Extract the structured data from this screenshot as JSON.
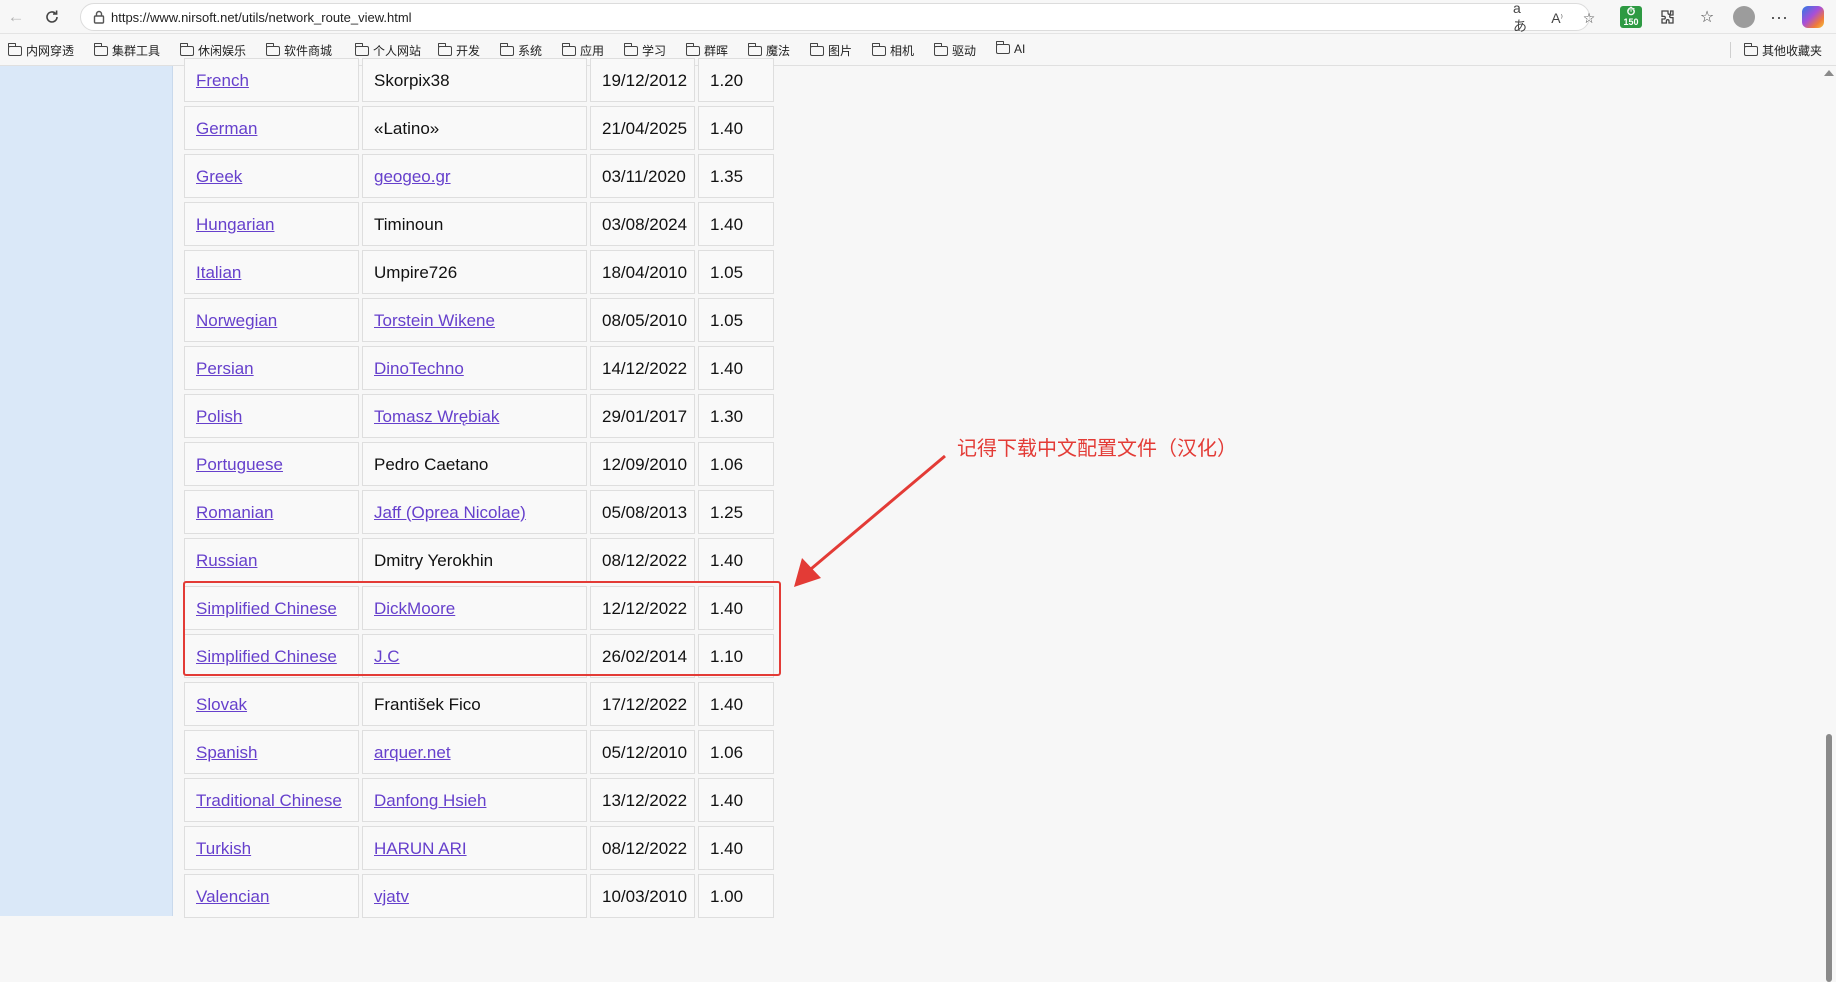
{
  "address_bar": {
    "url": "https://www.nirsoft.net/utils/network_route_view.html",
    "extension_badge": "150"
  },
  "bookmarks": {
    "items": [
      "内网穿透",
      "集群工具",
      "休闲娱乐",
      "软件商城",
      "个人网站",
      "开发",
      "系统",
      "应用",
      "学习",
      "群晖",
      "魔法",
      "图片",
      "相机",
      "驱动",
      "AI"
    ],
    "other": "其他收藏夹"
  },
  "table": {
    "rows": [
      {
        "language": "French",
        "translator": "Skorpix38",
        "translator_link": false,
        "date": "19/12/2012",
        "version": "1.20"
      },
      {
        "language": "German",
        "translator": "«Latino»",
        "translator_link": false,
        "date": "21/04/2025",
        "version": "1.40"
      },
      {
        "language": "Greek",
        "translator": "geogeo.gr",
        "translator_link": true,
        "date": "03/11/2020",
        "version": "1.35"
      },
      {
        "language": "Hungarian",
        "translator": "Timinoun",
        "translator_link": false,
        "date": "03/08/2024",
        "version": "1.40"
      },
      {
        "language": "Italian",
        "translator": "Umpire726",
        "translator_link": false,
        "date": "18/04/2010",
        "version": "1.05"
      },
      {
        "language": "Norwegian",
        "translator": "Torstein Wikene",
        "translator_link": true,
        "date": "08/05/2010",
        "version": "1.05"
      },
      {
        "language": "Persian",
        "translator": "DinoTechno",
        "translator_link": true,
        "date": "14/12/2022",
        "version": "1.40"
      },
      {
        "language": "Polish",
        "translator": "Tomasz Wrębiak",
        "translator_link": true,
        "date": "29/01/2017",
        "version": "1.30"
      },
      {
        "language": "Portuguese",
        "translator": "Pedro Caetano",
        "translator_link": false,
        "date": "12/09/2010",
        "version": "1.06"
      },
      {
        "language": "Romanian",
        "translator": "Jaff (Oprea Nicolae)",
        "translator_link": true,
        "date": "05/08/2013",
        "version": "1.25"
      },
      {
        "language": "Russian",
        "translator": "Dmitry Yerokhin",
        "translator_link": false,
        "date": "08/12/2022",
        "version": "1.40"
      },
      {
        "language": "Simplified Chinese",
        "translator": "DickMoore",
        "translator_link": true,
        "date": "12/12/2022",
        "version": "1.40"
      },
      {
        "language": "Simplified Chinese",
        "translator": "J.C",
        "translator_link": true,
        "date": "26/02/2014",
        "version": "1.10"
      },
      {
        "language": "Slovak",
        "translator": "František Fico",
        "translator_link": false,
        "date": "17/12/2022",
        "version": "1.40"
      },
      {
        "language": "Spanish",
        "translator": "arquer.net",
        "translator_link": true,
        "date": "05/12/2010",
        "version": "1.06"
      },
      {
        "language": "Traditional Chinese",
        "translator": "Danfong Hsieh",
        "translator_link": true,
        "date": "13/12/2022",
        "version": "1.40"
      },
      {
        "language": "Turkish",
        "translator": "HARUN ARI",
        "translator_link": true,
        "date": "08/12/2022",
        "version": "1.40"
      },
      {
        "language": "Valencian",
        "translator": "vjatv",
        "translator_link": true,
        "date": "10/03/2010",
        "version": "1.00"
      }
    ]
  },
  "annotation": {
    "text": "记得下载中文配置文件（汉化）",
    "color": "#e33b36"
  },
  "colors": {
    "link": "#6640cc",
    "sidebar": "#dae8f8",
    "highlight": "#e33b36"
  },
  "icons": {
    "back": "arrow-left-icon",
    "refresh": "refresh-icon",
    "lock": "lock-icon",
    "read_aloud": "read-aloud-icon",
    "translate": "translate-icon",
    "favorite": "star-icon",
    "extensions": "puzzle-icon",
    "favorites_list": "favorites-icon",
    "more": "more-icon",
    "copilot": "copilot-icon"
  }
}
